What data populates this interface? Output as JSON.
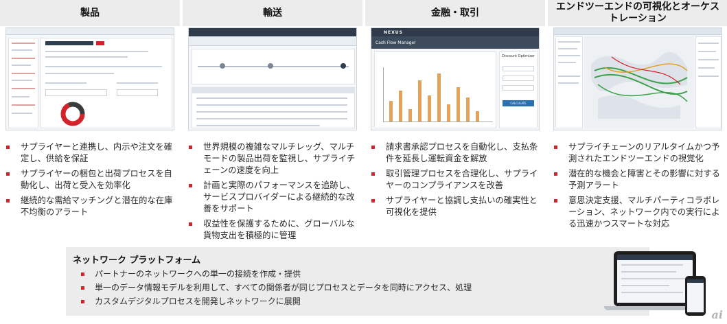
{
  "columns": [
    {
      "title": "製品",
      "bullets": [
        "サプライヤーと連携し、内示や注文を確定し、供給を保証",
        "サプライヤーの梱包と出荷プロセスを自動化し、出荷と受入を効率化",
        "継続的な需給マッチングと潜在的な在庫不均衡のアラート"
      ]
    },
    {
      "title": "輸送",
      "bullets": [
        "世界規模の複雑なマルチレッグ、マルチモードの製品出荷を監視し、サプライチェーンの速度を向上",
        "計画と実際のパフォーマンスを追跡し、サービスプロバイダーによる継続的な改善をサポート",
        "収益性を保護するために、グローバルな貨物支出を積極的に管理"
      ]
    },
    {
      "title": "金融・取引",
      "bullets": [
        "請求書承認プロセスを自動化し、支払条件を延長し運転資金を解放",
        "取引管理プロセスを合理化し、サプライヤーのコンプライアンスを改善",
        "サプライヤーと協調し支払いの確実性と可視化を提供"
      ]
    },
    {
      "title": "エンドツーエンドの可視化とオーケストレーション",
      "bullets": [
        "サプライチェーンのリアルタイムかつ予測されたエンドツーエンドの視覚化",
        "潜在的な機会と障害とその影響に対する予測アラート",
        "意思決定支援、マルチパーティコラボレーション、ネットワーク内での実行による迅速かつスマートな対応"
      ]
    }
  ],
  "screens": {
    "finance_app_title": "Cash Flow Manager",
    "finance_side_title": "Discount Optimizer",
    "apply_button": "CALCULATE",
    "shot3_logo": "NEXUS"
  },
  "network": {
    "title": "ネットワーク プラットフォーム",
    "bullets": [
      "パートナーのネットワークへの単一の接続を作成・提供",
      "単一のデータ情報モデルを利用して、すべての関係者が同じプロセスとデータを同時にアクセス、処理",
      "カスタムデジタルプロセスを開発しネットワークに展開"
    ]
  },
  "watermark": "ai",
  "colors": {
    "accent": "#d3232a",
    "header_bg": "#ececec",
    "nav_dark": "#2f3b4a",
    "bar": "#e6a25a",
    "map_line": "#3aa14a"
  }
}
